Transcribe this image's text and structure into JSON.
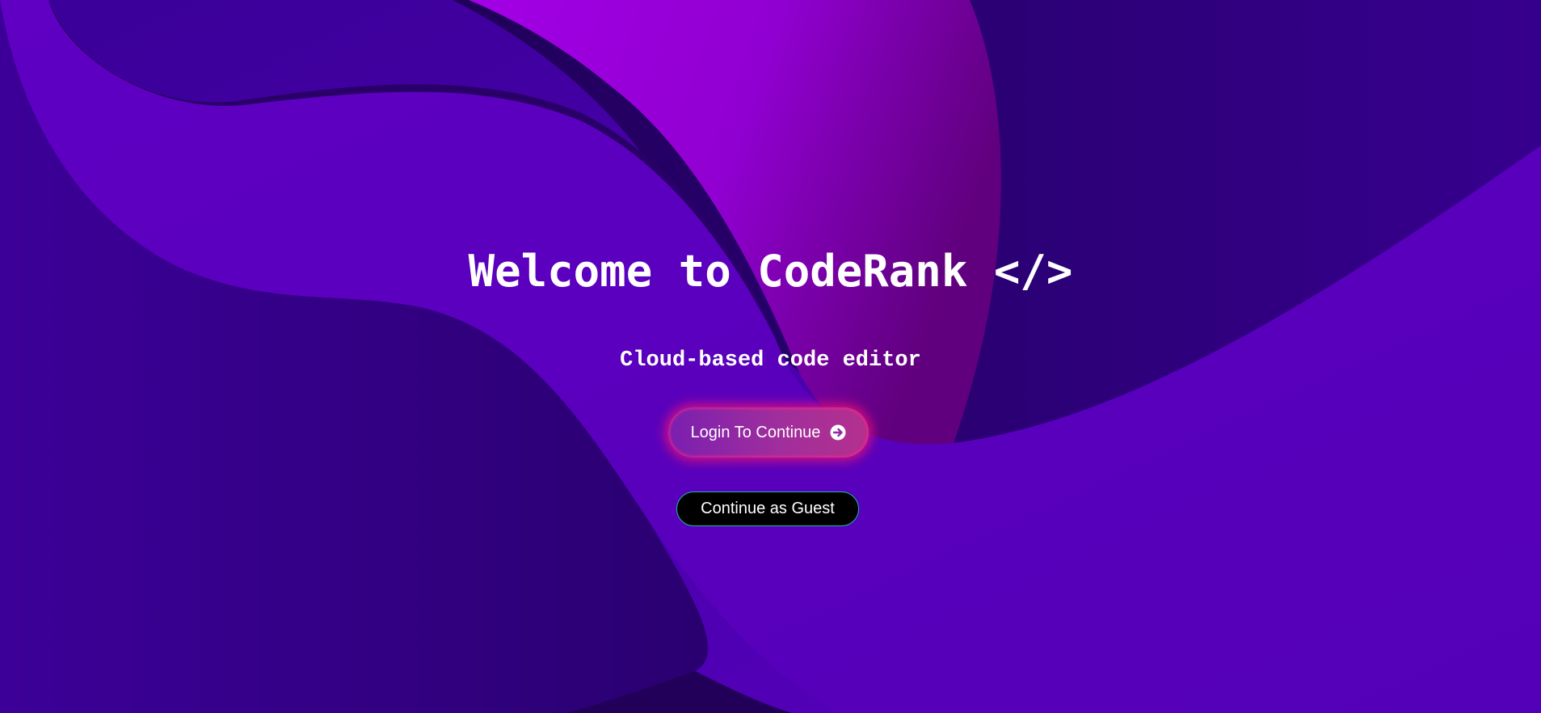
{
  "hero": {
    "title": "Welcome to CodeRank </>",
    "subtitle": "Cloud-based code editor"
  },
  "actions": {
    "login_label": "Login To Continue",
    "login_icon": "arrow-circle-right-icon",
    "guest_label": "Continue as Guest"
  },
  "colors": {
    "background": "#4a00b8",
    "accent_magenta": "#a000d8",
    "guest_border": "#19b9a7",
    "login_glow": "#e6147a"
  }
}
